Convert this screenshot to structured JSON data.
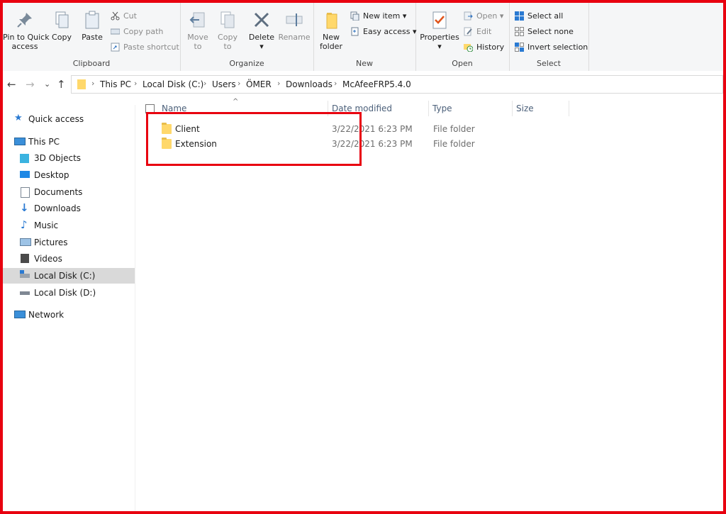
{
  "ribbon": {
    "clipboard": {
      "label": "Clipboard",
      "pin": "Pin to Quick\naccess",
      "copy": "Copy",
      "paste": "Paste",
      "cut": "Cut",
      "copy_path": "Copy path",
      "paste_shortcut": "Paste shortcut"
    },
    "organize": {
      "label": "Organize",
      "move_to": "Move\nto",
      "copy_to": "Copy\nto",
      "delete": "Delete",
      "rename": "Rename"
    },
    "new": {
      "label": "New",
      "new_folder": "New\nfolder",
      "new_item": "New item",
      "easy_access": "Easy access"
    },
    "open": {
      "label": "Open",
      "properties": "Properties",
      "open": "Open",
      "edit": "Edit",
      "history": "History"
    },
    "select": {
      "label": "Select",
      "select_all": "Select all",
      "select_none": "Select none",
      "invert": "Invert selection"
    }
  },
  "address": {
    "crumbs": [
      "This PC",
      "Local Disk (C:)",
      "Users",
      "ÖMER",
      "Downloads",
      "McAfeeFRP5.4.0"
    ]
  },
  "sidebar": {
    "items": [
      {
        "label": "Quick access",
        "icon": "star-icon"
      },
      {
        "label": "This PC",
        "icon": "computer-icon"
      },
      {
        "label": "3D Objects",
        "icon": "cube-icon"
      },
      {
        "label": "Desktop",
        "icon": "desktop-icon"
      },
      {
        "label": "Documents",
        "icon": "document-icon"
      },
      {
        "label": "Downloads",
        "icon": "download-arrow-icon"
      },
      {
        "label": "Music",
        "icon": "music-note-icon"
      },
      {
        "label": "Pictures",
        "icon": "picture-icon"
      },
      {
        "label": "Videos",
        "icon": "film-icon"
      },
      {
        "label": "Local Disk (C:)",
        "icon": "windows-drive-icon"
      },
      {
        "label": "Local Disk (D:)",
        "icon": "drive-icon"
      },
      {
        "label": "Network",
        "icon": "network-icon"
      }
    ]
  },
  "columns": {
    "name": "Name",
    "date": "Date modified",
    "type": "Type",
    "size": "Size"
  },
  "files": [
    {
      "name": "Client",
      "date": "3/22/2021 6:23 PM",
      "type": "File folder"
    },
    {
      "name": "Extension",
      "date": "3/22/2021 6:23 PM",
      "type": "File folder"
    }
  ],
  "colors": {
    "highlight": "#e8000f",
    "accent": "#0078d7",
    "folder": "#ffd86b"
  }
}
